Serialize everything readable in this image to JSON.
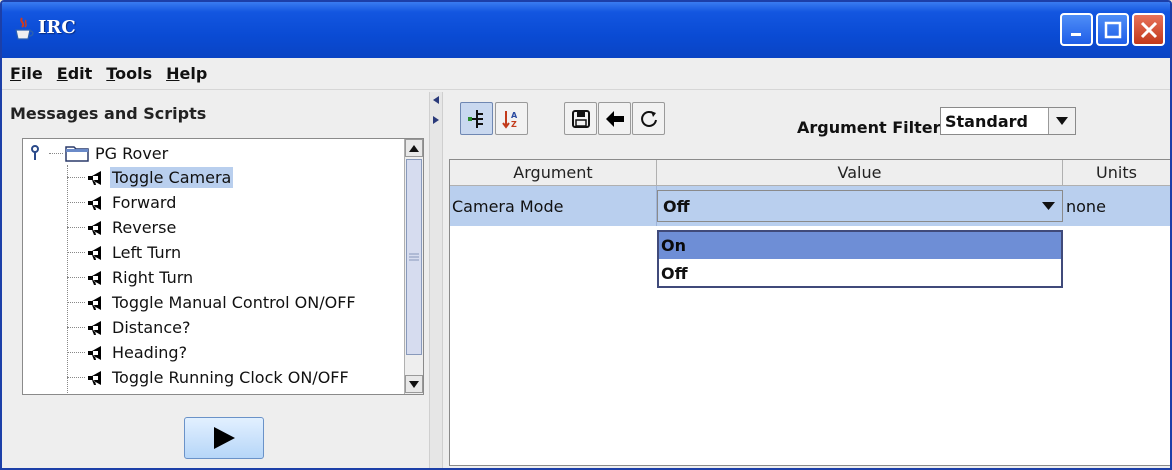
{
  "window": {
    "title": "IRC"
  },
  "menu": [
    {
      "mnemonic": "F",
      "rest": "ile"
    },
    {
      "mnemonic": "E",
      "rest": "dit"
    },
    {
      "mnemonic": "T",
      "rest": "ools"
    },
    {
      "mnemonic": "H",
      "rest": "elp"
    }
  ],
  "left": {
    "title": "Messages and Scripts",
    "root": "PG Rover",
    "items": [
      "Toggle Camera",
      "Forward",
      "Reverse",
      "Left Turn",
      "Right Turn",
      "Toggle Manual Control ON/OFF",
      "Distance?",
      "Heading?",
      "Toggle Running Clock ON/OFF"
    ],
    "selected_index": 0
  },
  "right": {
    "filter_label": "Argument Filter:",
    "filter_value": "Standard",
    "columns": [
      "Argument",
      "Value",
      "Units"
    ],
    "row": {
      "argument": "Camera Mode",
      "value": "Off",
      "units": "none"
    },
    "options": [
      "On",
      "Off"
    ],
    "highlighted_option": 0
  },
  "colors": {
    "titlebar": "#0a4bd4",
    "selection": "#b9cfee",
    "option_highlight": "#6e8ed6"
  },
  "icons": {
    "title": "java-cup-icon",
    "tree_item": "megaphone-icon",
    "root": "folder-icon",
    "toolbar": [
      "tree-view-icon",
      "sort-az-icon",
      "save-icon",
      "back-arrow-icon",
      "refresh-icon"
    ],
    "run": "play-icon"
  }
}
